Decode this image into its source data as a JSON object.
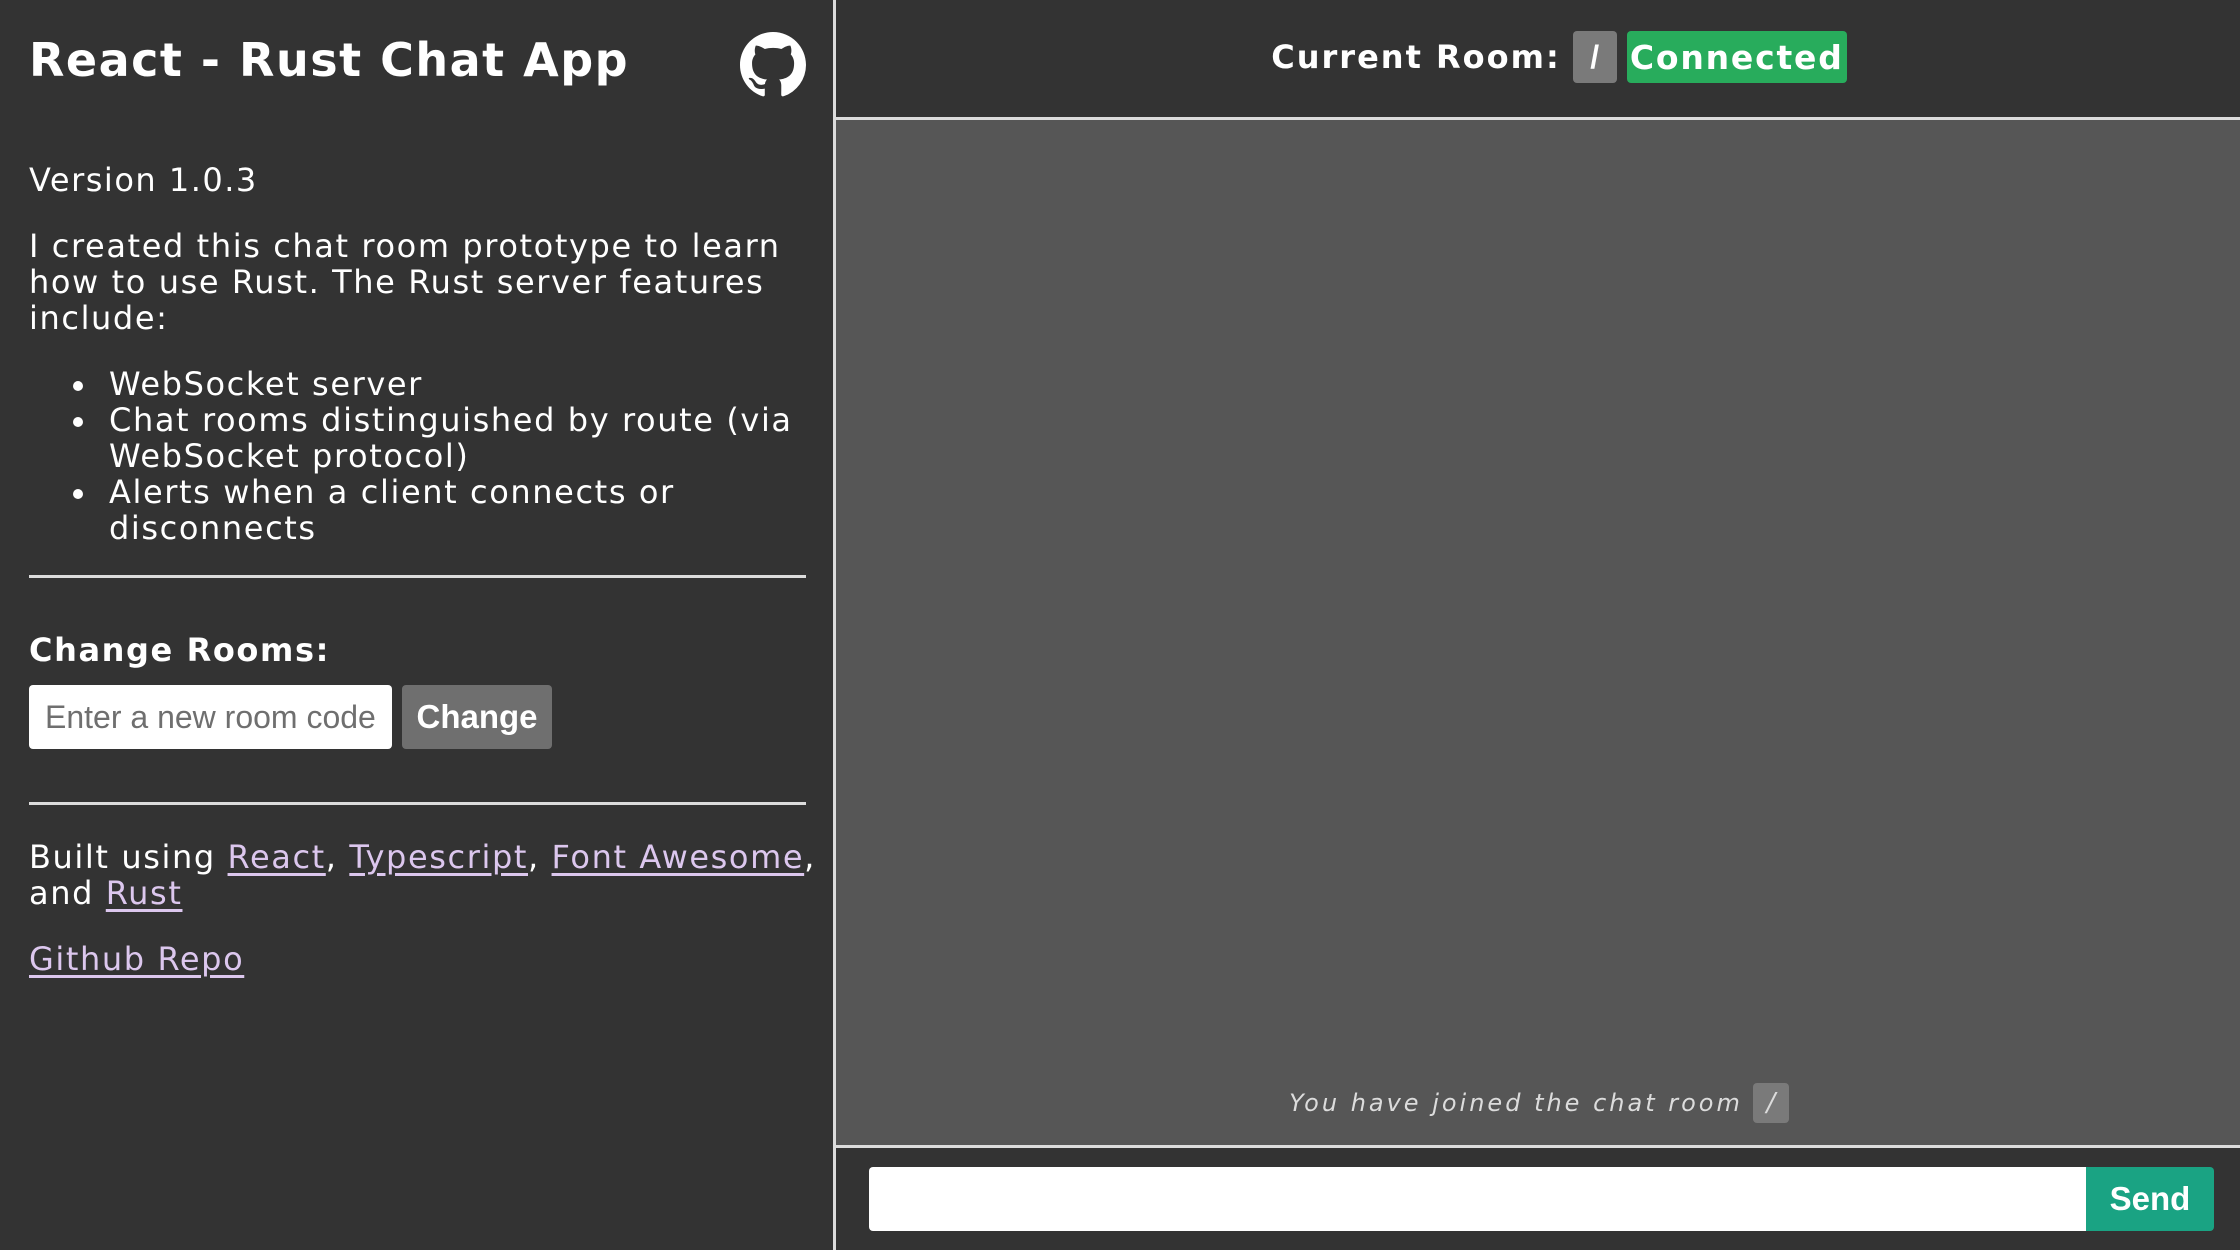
{
  "sidebar": {
    "title": "React - Rust Chat App",
    "github_icon": "github-icon",
    "version": "Version 1.0.3",
    "intro": "I created this chat room prototype to learn how to use Rust. The Rust server features include:",
    "features": [
      "WebSocket server",
      "Chat rooms distinguished by route (via WebSocket protocol)",
      "Alerts when a client connects or disconnects"
    ],
    "change_rooms": {
      "label": "Change Rooms:",
      "input_placeholder": "Enter a new room code",
      "input_value": "",
      "button_label": "Change"
    },
    "built_using": {
      "prefix": "Built using ",
      "links": [
        "React",
        "Typescript",
        "Font Awesome",
        "Rust"
      ],
      "sep1": ", ",
      "sep2": ", ",
      "sep3": ", and "
    },
    "repo_link": "Github Repo"
  },
  "room_header": {
    "label": "Current Room:",
    "room_code": "/",
    "status": "Connected"
  },
  "messages": {
    "system_message": "You have joined the chat room",
    "system_room_code": "/"
  },
  "composer": {
    "input_value": "",
    "send_label": "Send"
  },
  "colors": {
    "background": "#333333",
    "messages_background": "#565656",
    "status_connected": "#28ac5c",
    "send_button": "#1aa383",
    "link": "#dcc7ee",
    "badge": "#7a7a7a"
  }
}
